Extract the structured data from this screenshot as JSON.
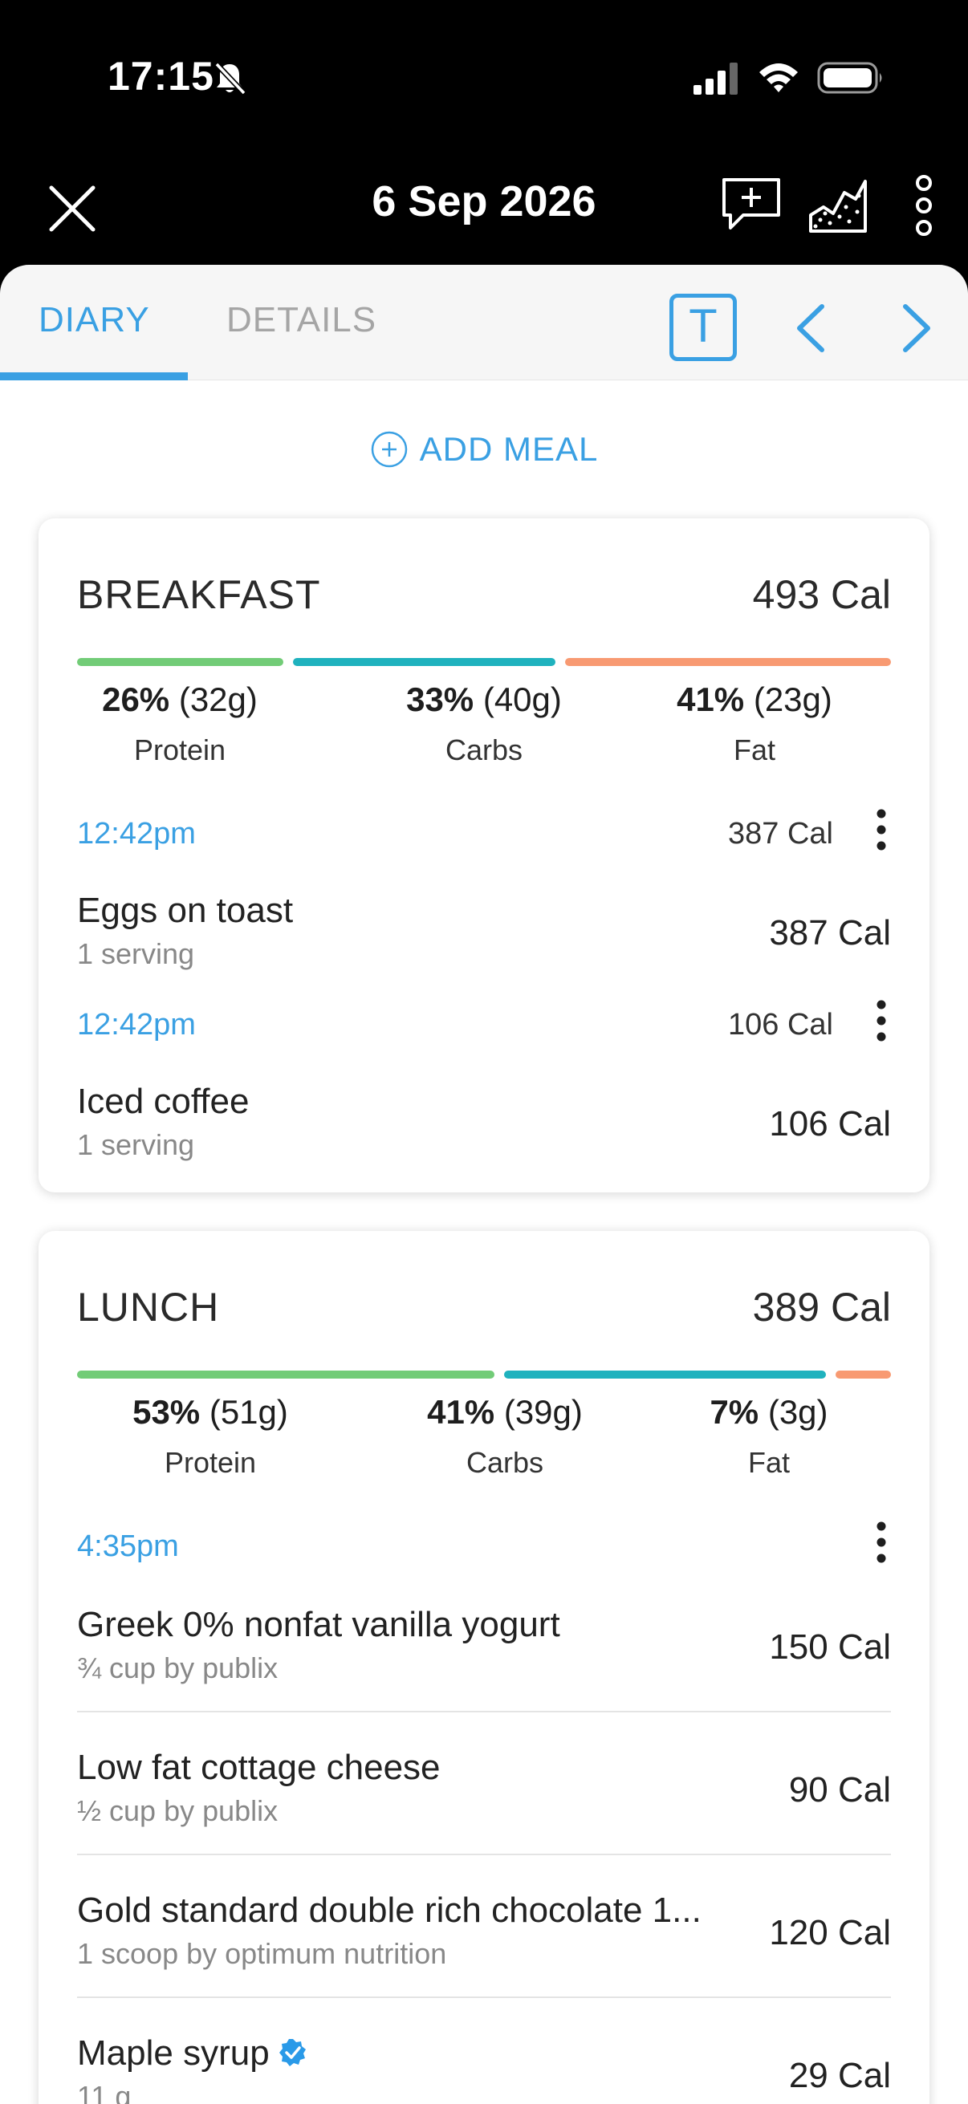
{
  "status": {
    "time": "17:15"
  },
  "header": {
    "date": "6 Sep 2026"
  },
  "tabs": [
    {
      "label": "DIARY",
      "active": true
    },
    {
      "label": "DETAILS",
      "active": false
    }
  ],
  "tabbar": {
    "text_mode_label": "T"
  },
  "add_meal_label": "ADD MEAL",
  "colors": {
    "accent": "#3aa0e3",
    "protein": "#72cc77",
    "carbs": "#1fb2be",
    "fat": "#f89a72"
  },
  "meals": [
    {
      "title": "BREAKFAST",
      "calories": "493 Cal",
      "macros": [
        {
          "pct": "26%",
          "grams": "(32g)",
          "name": "Protein",
          "share": 0.26
        },
        {
          "pct": "33%",
          "grams": "(40g)",
          "name": "Carbs",
          "share": 0.33
        },
        {
          "pct": "41%",
          "grams": "(23g)",
          "name": "Fat",
          "share": 0.41
        }
      ],
      "entries": [
        {
          "time": "12:42pm",
          "total": "387 Cal",
          "foods": [
            {
              "name": "Eggs on toast",
              "serving": "1 serving",
              "calories": "387 Cal"
            }
          ]
        },
        {
          "time": "12:42pm",
          "total": "106 Cal",
          "foods": [
            {
              "name": "Iced coffee",
              "serving": "1 serving",
              "calories": "106 Cal"
            }
          ]
        }
      ]
    },
    {
      "title": "LUNCH",
      "calories": "389 Cal",
      "macros": [
        {
          "pct": "53%",
          "grams": "(51g)",
          "name": "Protein",
          "share": 0.53
        },
        {
          "pct": "41%",
          "grams": "(39g)",
          "name": "Carbs",
          "share": 0.41
        },
        {
          "pct": "7%",
          "grams": "(3g)",
          "name": "Fat",
          "share": 0.07
        }
      ],
      "entries": [
        {
          "time": "4:35pm",
          "total": "",
          "foods": [
            {
              "name": "Greek 0% nonfat vanilla yogurt",
              "serving": "¾ cup by publix",
              "calories": "150 Cal"
            },
            {
              "name": "Low fat cottage cheese",
              "serving": "½ cup by publix",
              "calories": "90 Cal"
            },
            {
              "name": "Gold standard double rich chocolate 1...",
              "serving": "1 scoop by optimum nutrition",
              "calories": "120 Cal"
            },
            {
              "name": "Maple syrup",
              "serving": "11 g",
              "calories": "29 Cal",
              "verified": true
            }
          ]
        }
      ]
    }
  ]
}
